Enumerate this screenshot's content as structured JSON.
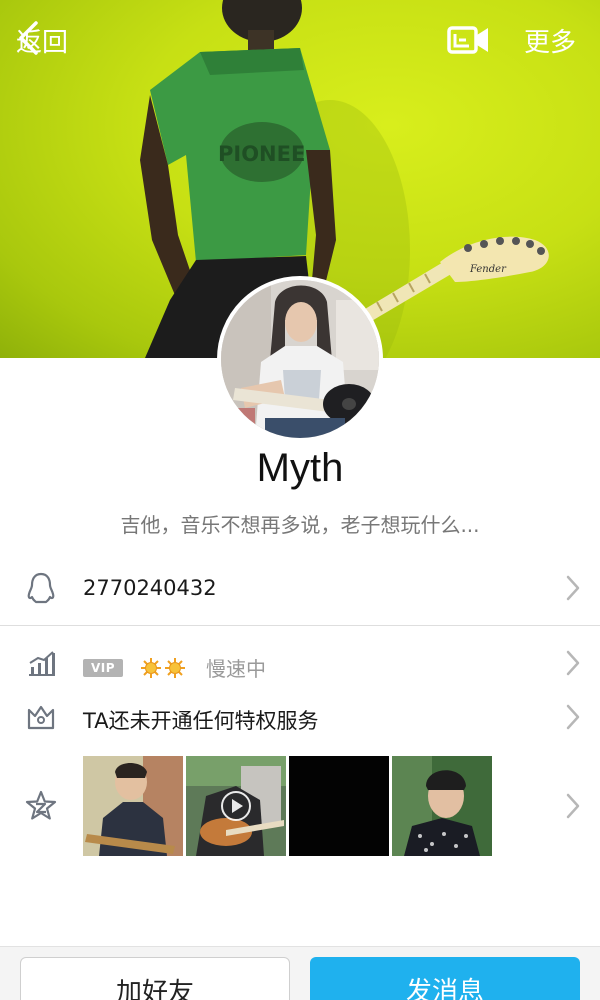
{
  "header": {
    "back_label": "返回",
    "more_label": "更多",
    "video_icon": "video-call-icon"
  },
  "cover": {
    "shirt_text": "PIONEE",
    "guitar_brand": "Fender",
    "background_color": "#c7e014"
  },
  "profile": {
    "name": "Myth",
    "bio": "吉他，音乐不想再多说，老子想玩什么..."
  },
  "rows": {
    "qq_number": "2770240432",
    "vip_badge": "VIP",
    "vip_status": "慢速中",
    "privilege_text": "TA还未开通任何特权服务"
  },
  "icons": {
    "qq": "qq-penguin-icon",
    "level": "level-chart-icon",
    "privilege": "crown-icon",
    "album": "qzone-star-icon",
    "level_suns": "sun-icon"
  },
  "colors": {
    "accent": "#1fb1ee",
    "vip_gray": "#b3b3b3",
    "sun": "#f0a020"
  },
  "buttons": {
    "add_friend": "加好友",
    "send_message": "发消息"
  }
}
